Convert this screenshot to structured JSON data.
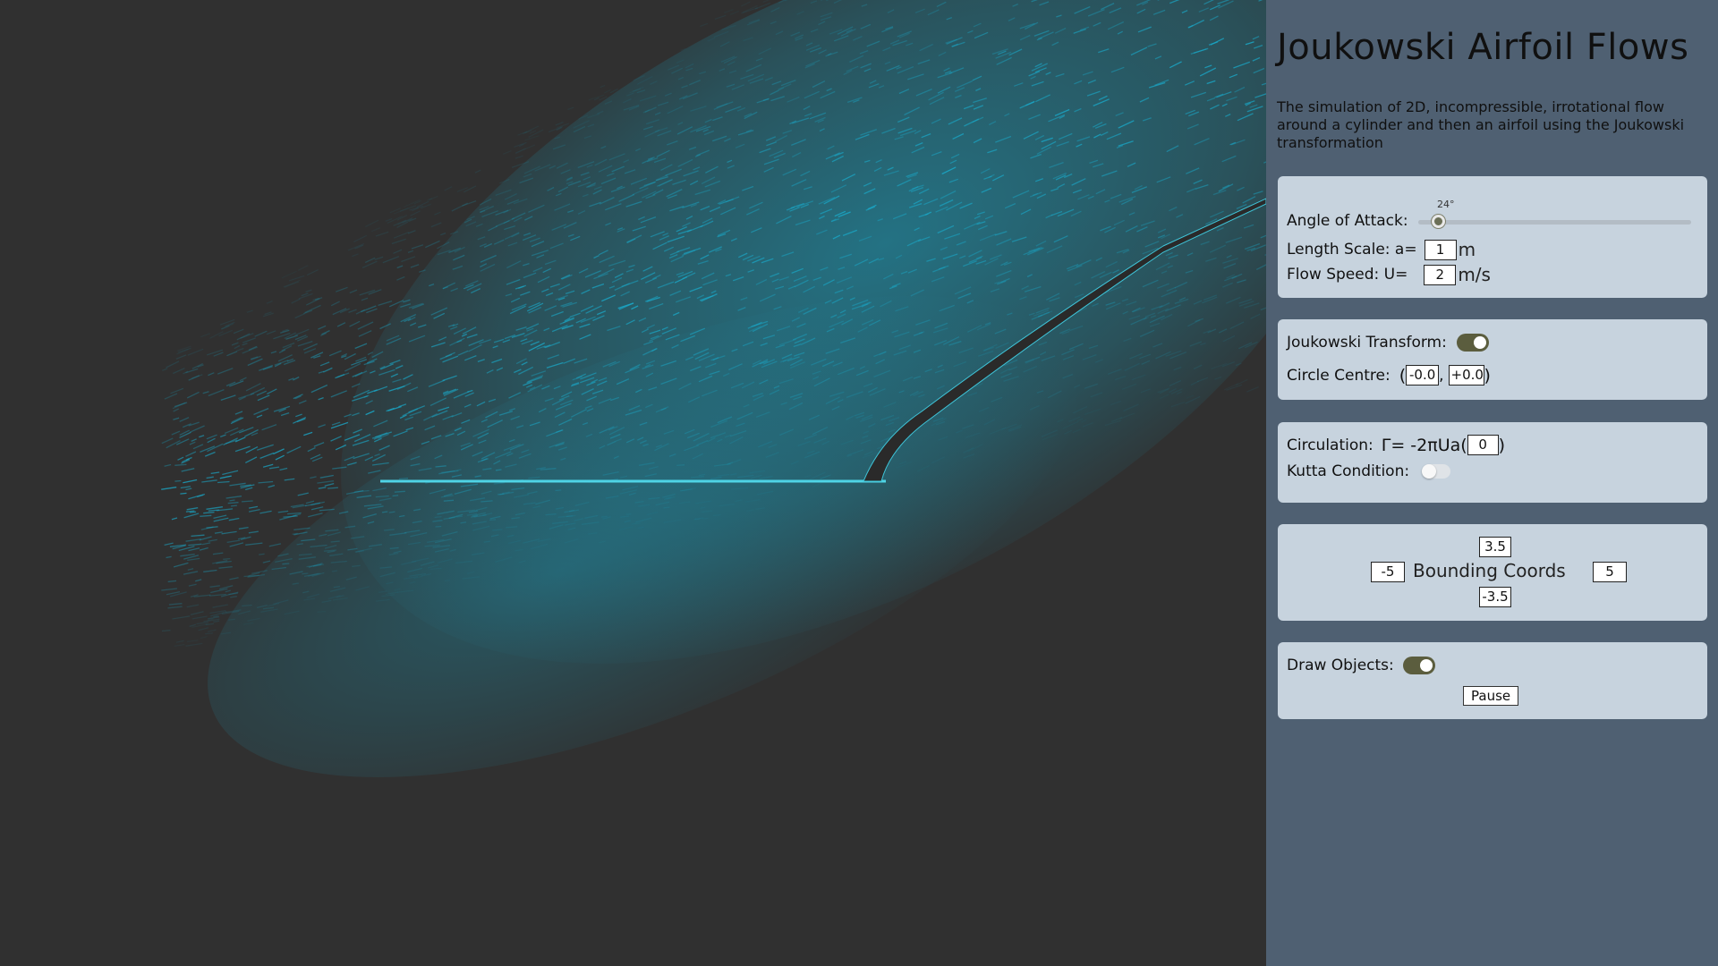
{
  "app": {
    "title": "Joukowski Airfoil Flows",
    "description": "The simulation of 2D, incompressible, irrotational flow around a cylinder and then an airfoil using the Joukowski transformation"
  },
  "colors": {
    "particle": "#1aa8c8",
    "background": "#303030",
    "panel": "#4f6072",
    "card": "#c7d3de",
    "toggle_on": "#5b5d3e"
  },
  "params": {
    "angle_label": "Angle of Attack:",
    "angle_value": "24°",
    "angle_fraction": 0.08,
    "length_label": "Length Scale: a=",
    "length_value": "1",
    "length_unit": "m",
    "speed_label": "Flow Speed: U=",
    "speed_value": "2",
    "speed_unit": "m/s"
  },
  "transform": {
    "label": "Joukowski Transform:",
    "enabled": true,
    "centre_label": "Circle Centre:",
    "open_paren": "(",
    "comma": ",",
    "close_paren": ")",
    "centre_x": "-0.0",
    "centre_y": "+0.0"
  },
  "circulation": {
    "label": "Circulation:",
    "formula": "Γ= -2πUa(",
    "value": "0",
    "close": ")",
    "kutta_label": "Kutta Condition:",
    "kutta_enabled": false
  },
  "bounds": {
    "label": "Bounding Coords",
    "top": "3.5",
    "left": "-5",
    "right": "5",
    "bottom": "-3.5"
  },
  "draw": {
    "label": "Draw Objects:",
    "enabled": true,
    "pause_label": "Pause"
  }
}
